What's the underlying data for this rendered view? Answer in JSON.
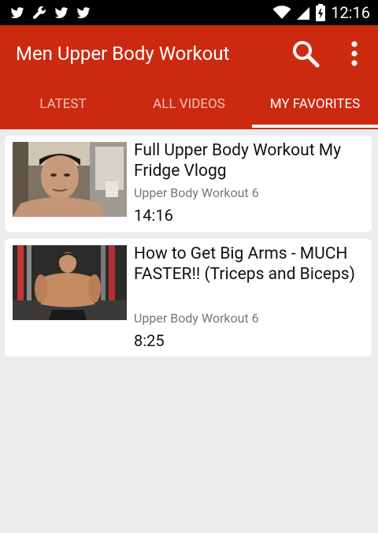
{
  "status_bar": {
    "time": "12:16",
    "left_icons": [
      "twitter-icon",
      "wrench-icon",
      "twitter-icon",
      "twitter-icon"
    ],
    "right_icons": [
      "wifi-icon",
      "signal-icon",
      "battery-icon"
    ]
  },
  "app_bar": {
    "title": "Men Upper Body Workout",
    "icons": [
      "search-icon",
      "more-vert-icon"
    ],
    "color": "#cc2a10"
  },
  "tabs": [
    {
      "label": "LATEST",
      "active": false
    },
    {
      "label": "ALL VIDEOS",
      "active": false
    },
    {
      "label": "MY FAVORITES",
      "active": true
    }
  ],
  "videos": [
    {
      "title": "Full Upper Body Workout My Fridge Vlogg",
      "channel": "Upper Body Workout 6",
      "duration": "14:16"
    },
    {
      "title": "How to Get Big Arms - MUCH FASTER!! (Triceps and Biceps)",
      "channel": "Upper Body Workout 6",
      "duration": "8:25"
    }
  ]
}
